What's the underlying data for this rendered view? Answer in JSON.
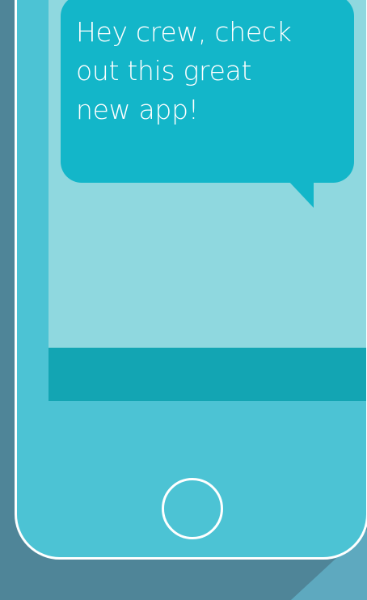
{
  "chat": {
    "message": "Hey crew, check\nout this great\nnew app!"
  },
  "colors": {
    "background": "#4f8598",
    "phone_body": "#4cc3d4",
    "screen": "#8fd8df",
    "status_bar": "#19b7c5",
    "bubble": "#13b6c9",
    "input_bar": "#13a5b3",
    "outline": "#ffffff"
  },
  "icons": {
    "home_button": "home-button-circle"
  }
}
